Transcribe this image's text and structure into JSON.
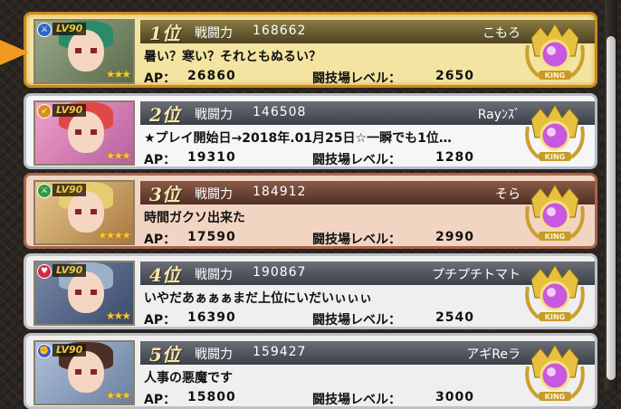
{
  "ranking": [
    {
      "level_label": "LV90",
      "element": "sword",
      "element_color": "#2a66c8",
      "stars": "★★★",
      "rank": "1位",
      "power_label": "戦闘力",
      "power": "168662",
      "player": "こもろ",
      "comment": "暑い？寒い？それともぬるい？",
      "ap_label": "AP：",
      "ap": "26860",
      "arena_label": "闘技場レベル：",
      "arena_level": "2650",
      "crest": "KING",
      "card_style": "gold",
      "portrait_bg": "#7a8a6a",
      "hair_color": "#2a8a6a"
    },
    {
      "level_label": "LV90",
      "element": "bow",
      "element_color": "#d89018",
      "stars": "★★★",
      "rank": "2位",
      "power_label": "戦闘力",
      "power": "146508",
      "player": "Rayﾝｽﾞ",
      "comment": "★プレイ開始日→2018年.01月25日☆一瞬でも1位…",
      "ap_label": "AP：",
      "ap": "19310",
      "arena_label": "闘技場レベル：",
      "arena_level": "1280",
      "crest": "KING",
      "card_style": "silver",
      "portrait_bg": "#d87aa0",
      "hair_color": "#e04848"
    },
    {
      "level_label": "LV90",
      "element": "sword",
      "element_color": "#2e9a3e",
      "stars": "★★★★",
      "rank": "3位",
      "power_label": "戦闘力",
      "power": "184912",
      "player": "そら",
      "comment": "時間ガクソ出来た",
      "ap_label": "AP：",
      "ap": "17590",
      "arena_label": "闘技場レベル：",
      "arena_level": "2990",
      "crest": "KING",
      "card_style": "bronze",
      "portrait_bg": "#c8a060",
      "hair_color": "#e8cc70"
    },
    {
      "level_label": "LV90",
      "element": "heart",
      "element_color": "#d82a3a",
      "stars": "★★★",
      "rank": "4位",
      "power_label": "戦闘力",
      "power": "190867",
      "player": "プチプチトマト",
      "comment": "いやだあぁぁぁまだ上位にいだいぃぃぃ",
      "ap_label": "AP：",
      "ap": "16390",
      "arena_label": "闘技場レベル：",
      "arena_level": "2540",
      "crest": "KING",
      "card_style": "plain",
      "portrait_bg": "#5a6a8a",
      "hair_color": "#9ab0c8"
    },
    {
      "level_label": "LV90",
      "element": "fist",
      "element_color": "#3a5ac8",
      "stars": "★★★",
      "rank": "5位",
      "power_label": "戦闘力",
      "power": "159427",
      "player": "アギReラ",
      "comment": "人事の悪魔です",
      "ap_label": "AP：",
      "ap": "15800",
      "arena_label": "闘技場レベル：",
      "arena_level": "3000",
      "crest": "KING",
      "card_style": "plain",
      "portrait_bg": "#8aa0b8",
      "hair_color": "#4a3028"
    }
  ],
  "colors": {
    "gold_border": "#c98a1e",
    "pointer": "#f29a1d"
  }
}
